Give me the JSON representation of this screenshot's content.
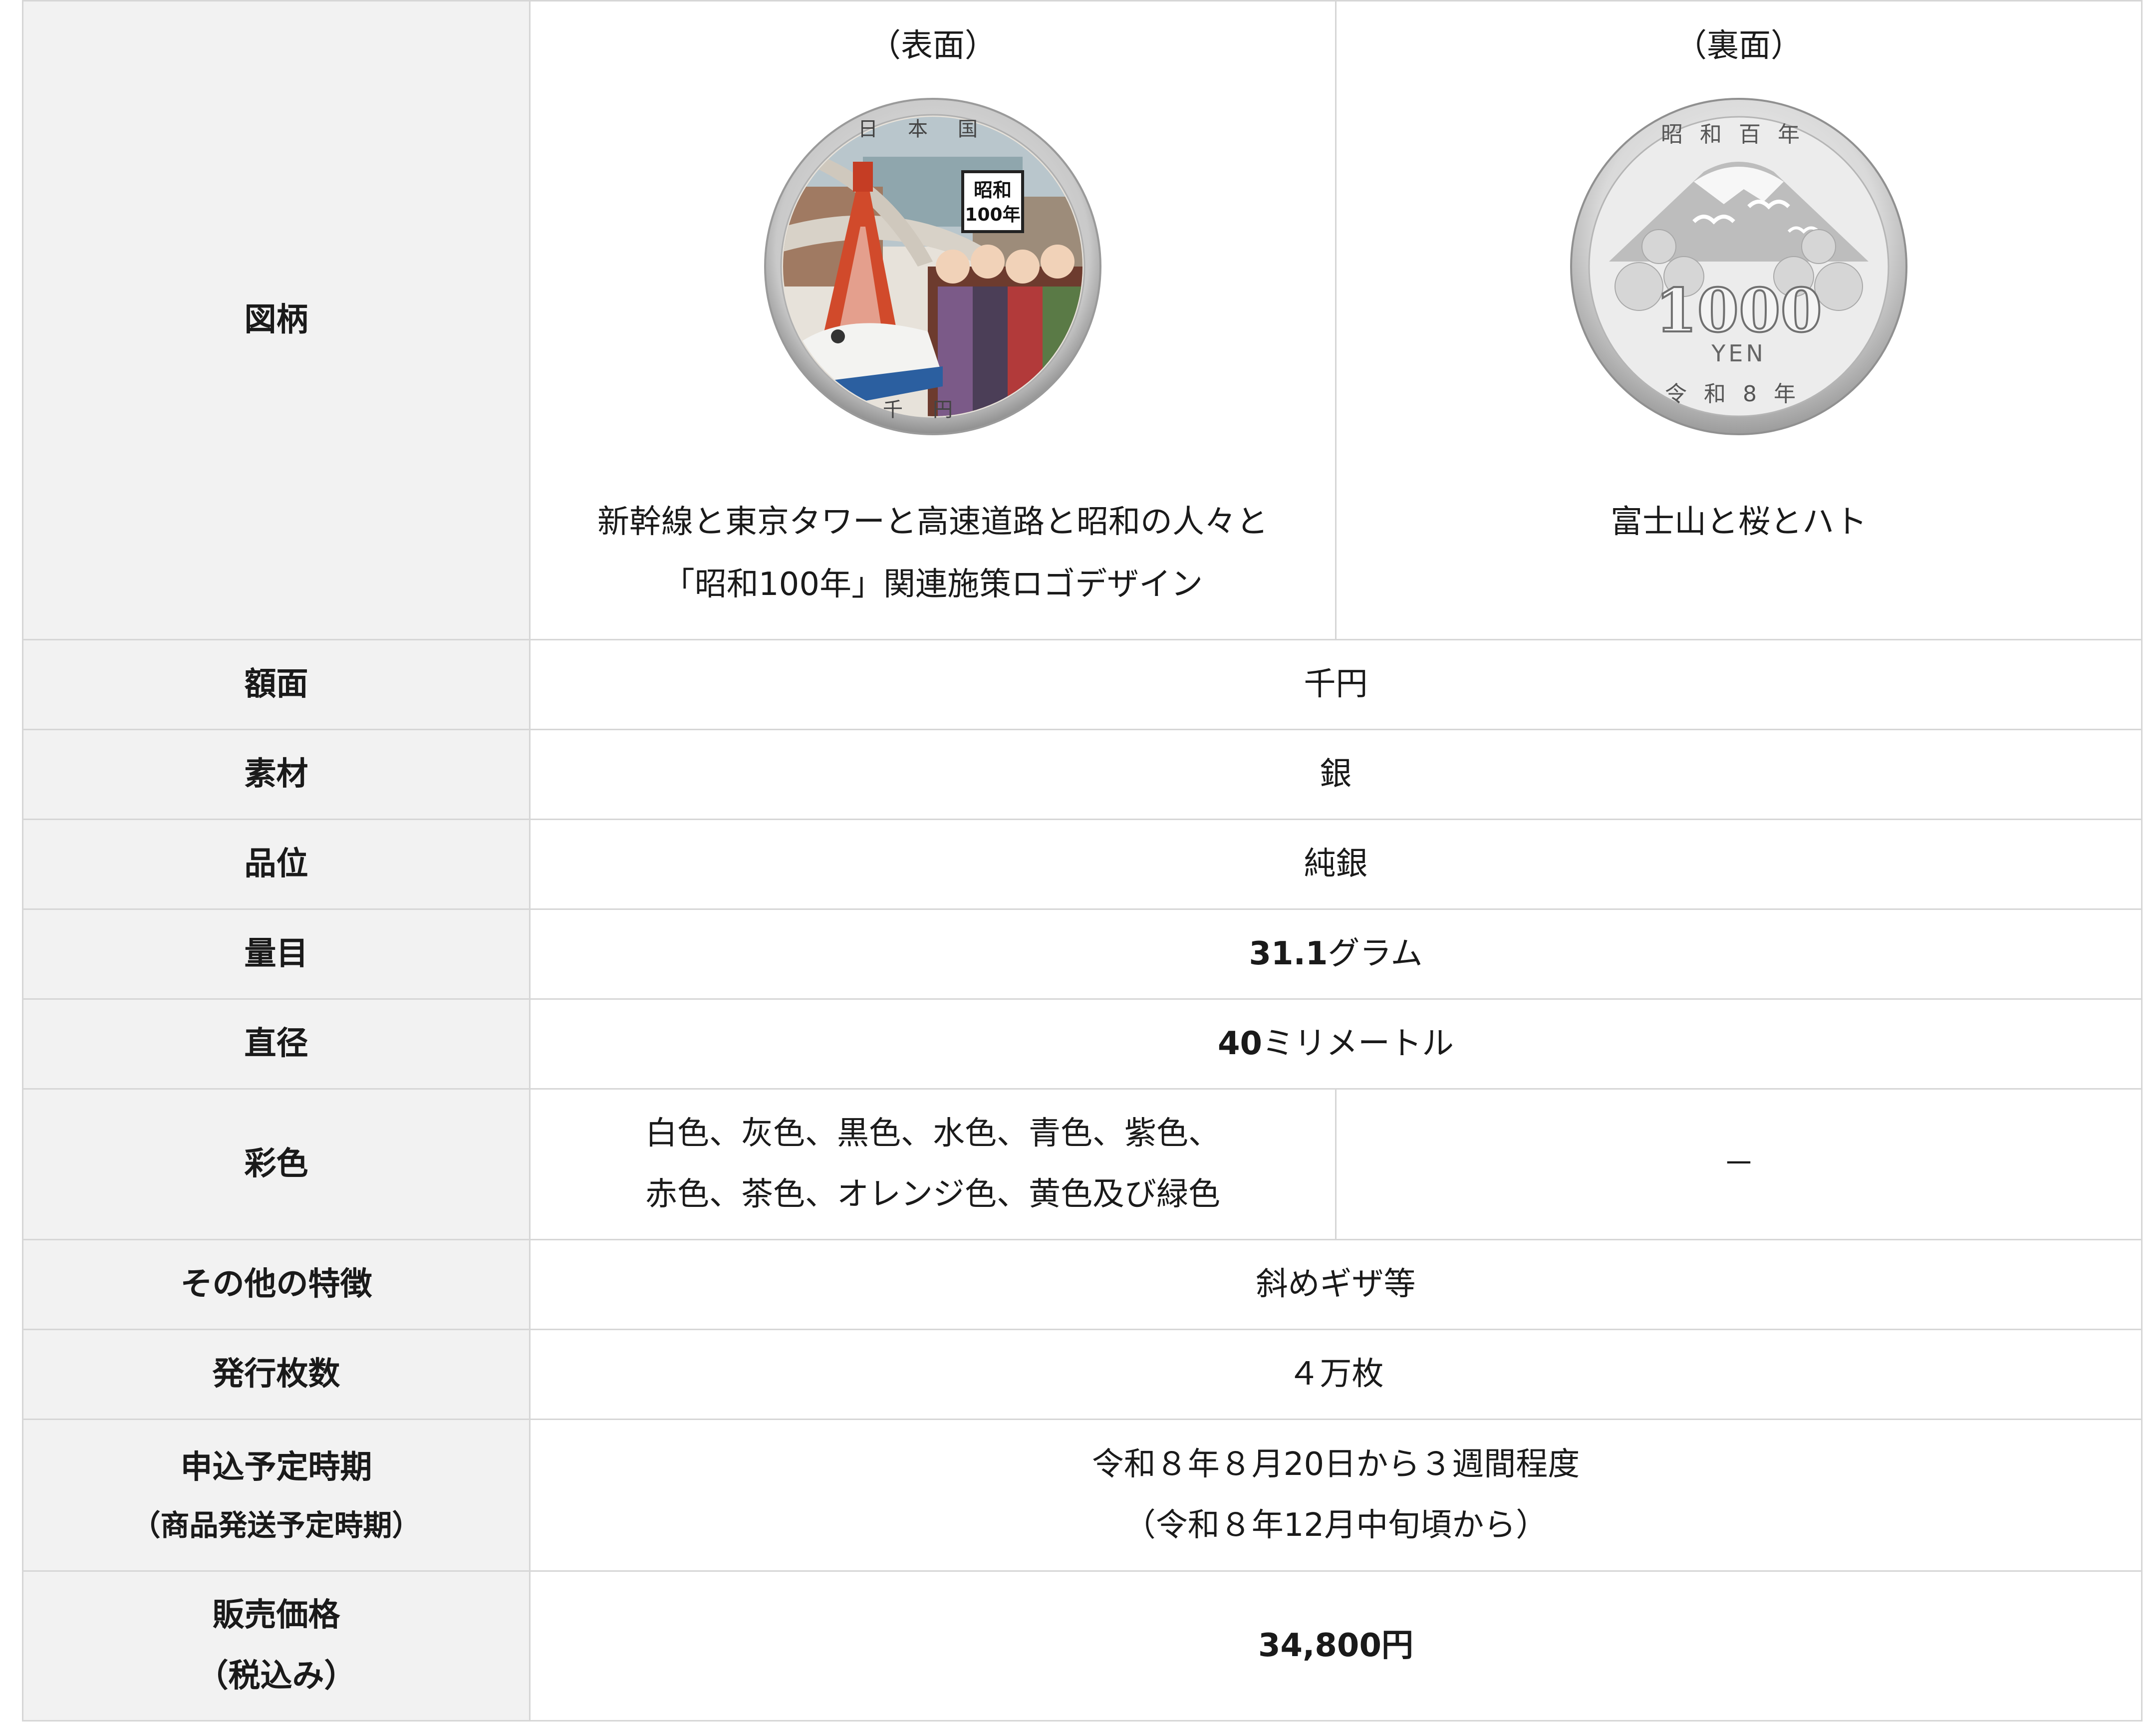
{
  "rows": {
    "design": {
      "label": "図柄",
      "front": {
        "title": "（表面）",
        "caption_line1": "新幹線と東京タワーと高速道路と昭和の人々と",
        "caption_line2": "「昭和100年」関連施策ロゴデザイン",
        "coin_text_top": "日本国",
        "coin_text_bottom": "千円",
        "logo_line1": "昭和",
        "logo_line2": "100年"
      },
      "back": {
        "title": "（裏面）",
        "caption": "富士山と桜とハト",
        "coin_text_top": "昭和百年",
        "coin_value": "1000",
        "coin_unit": "YEN",
        "coin_text_bottom": "令和8年"
      }
    },
    "face_value": {
      "label": "額面",
      "value": "千円"
    },
    "material": {
      "label": "素材",
      "value": "銀"
    },
    "grade": {
      "label": "品位",
      "value": "純銀"
    },
    "weight": {
      "label": "量目",
      "num": "31.1",
      "unit": "グラム"
    },
    "diameter": {
      "label": "直径",
      "num": "40",
      "unit": "ミリメートル"
    },
    "coloring": {
      "label": "彩色",
      "front_line1": "白色、灰色、黒色、水色、青色、紫色、",
      "front_line2": "赤色、茶色、オレンジ色、黄色及び緑色",
      "back": "－"
    },
    "other": {
      "label": "その他の特徴",
      "value": "斜めギザ等"
    },
    "mintage": {
      "label": "発行枚数",
      "value": "４万枚"
    },
    "application": {
      "label_line1": "申込予定時期",
      "label_line2": "（商品発送予定時期）",
      "value_line1": "令和８年８月20日から３週間程度",
      "value_line2": "（令和８年12月中旬頃から）"
    },
    "price": {
      "label_line1": "販売価格",
      "label_line2": "（税込み）",
      "value": "34,800円"
    }
  }
}
